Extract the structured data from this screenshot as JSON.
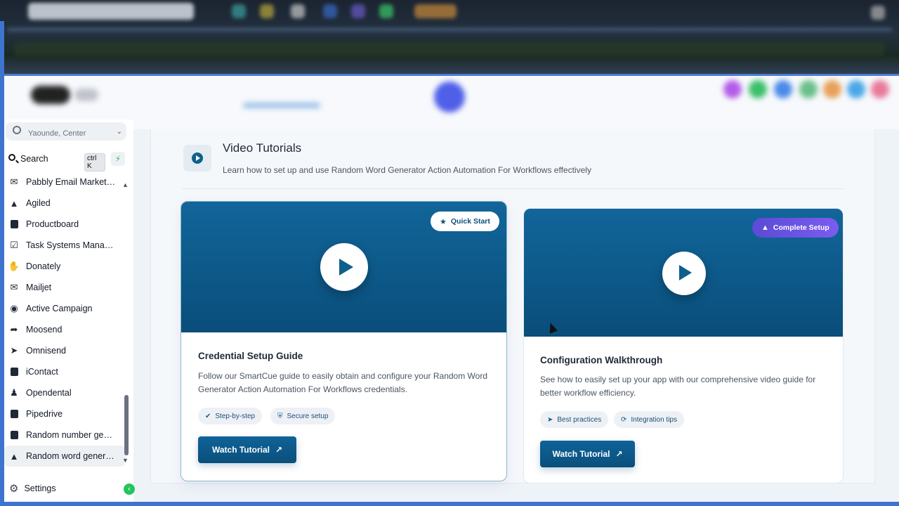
{
  "sidebar": {
    "location": "Yaounde, Center",
    "search_label": "Search",
    "search_shortcut": "ctrl K",
    "items": [
      {
        "label": "Pabbly Email Marketing",
        "icon": "envelope-icon"
      },
      {
        "label": "Agiled",
        "icon": "agiled-icon"
      },
      {
        "label": "Productboard",
        "icon": "document-icon"
      },
      {
        "label": "Task Systems Manage...",
        "icon": "checkbox-icon"
      },
      {
        "label": "Donately",
        "icon": "hand-donate-icon"
      },
      {
        "label": "Mailjet",
        "icon": "envelope-icon"
      },
      {
        "label": "Active Campaign",
        "icon": "wordpress-icon"
      },
      {
        "label": "Moosend",
        "icon": "share-arrow-icon"
      },
      {
        "label": "Omnisend",
        "icon": "paper-plane-icon"
      },
      {
        "label": "iContact",
        "icon": "contact-book-icon"
      },
      {
        "label": "Opendental",
        "icon": "user-icon"
      },
      {
        "label": "Pipedrive",
        "icon": "note-icon"
      },
      {
        "label": "Random number gene...",
        "icon": "document-icon"
      },
      {
        "label": "Random word generat...",
        "icon": "agiled-icon"
      }
    ],
    "settings_label": "Settings"
  },
  "main": {
    "title": "Video Tutorials",
    "subtitle": "Learn how to set up and use Random Word Generator Action Automation For Workflows effectively",
    "cards": [
      {
        "badge": "Quick Start",
        "badge_icon": "star-icon",
        "title": "Credential Setup Guide",
        "description": "Follow our SmartCue guide to easily obtain and configure your Random Word Generator Action Automation For Workflows credentials.",
        "chips": [
          {
            "label": "Step-by-step",
            "icon": "check-circle-icon"
          },
          {
            "label": "Secure setup",
            "icon": "shield-icon"
          }
        ],
        "button": "Watch Tutorial"
      },
      {
        "badge": "Complete Setup",
        "badge_icon": "graduation-cap-icon",
        "title": "Configuration Walkthrough",
        "description": "See how to easily set up your app with our comprehensive video guide for better workflow efficiency.",
        "chips": [
          {
            "label": "Best practices",
            "icon": "rocket-icon"
          },
          {
            "label": "Integration tips",
            "icon": "sync-icon"
          }
        ],
        "button": "Watch Tutorial"
      }
    ]
  },
  "colors": {
    "accent": "#0f5f8d",
    "complete_badge": "#6a55e6",
    "active_green": "#22c55e"
  }
}
